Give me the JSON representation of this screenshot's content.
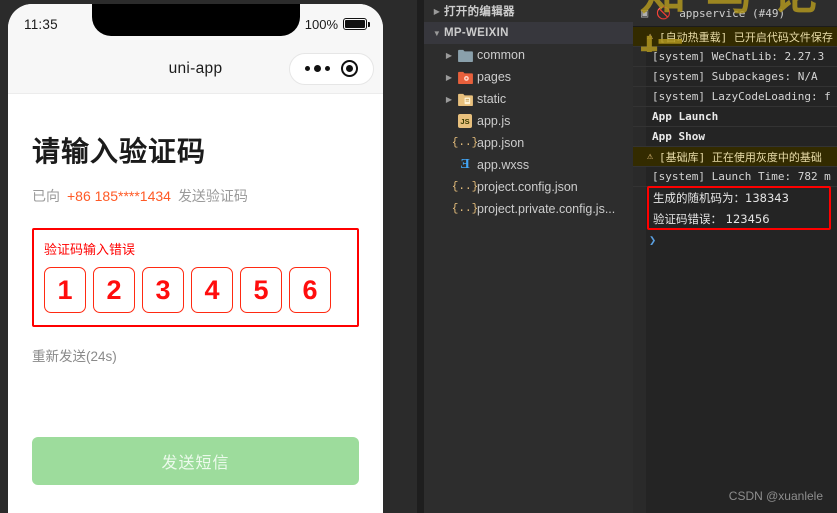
{
  "phone": {
    "statusbar": {
      "time": "11:35",
      "battery_pct": "100%"
    },
    "navbar": {
      "title": "uni-app",
      "capsule_more_icon": "more-dots-icon",
      "capsule_target_icon": "target-icon"
    },
    "content": {
      "heading": "请输入验证码",
      "sub_prefix": "已向",
      "phone_number": "+86 185****1434",
      "sub_suffix": "发送验证码",
      "error_text": "验证码输入错误",
      "code_digits": [
        "1",
        "2",
        "3",
        "4",
        "5",
        "6"
      ],
      "resend_text": "重新发送(24s)",
      "send_button": "发送短信"
    },
    "colors": {
      "error_red": "#ff0000",
      "phone_orange": "#ff5a26",
      "button_green": "#9ddc9c"
    }
  },
  "explorer": {
    "sections": [
      {
        "label": "打开的编辑器",
        "expanded": false,
        "icon": "chevron-right-icon"
      },
      {
        "label": "MP-WEIXIN",
        "expanded": true,
        "icon": "chevron-down-icon",
        "active": true
      }
    ],
    "files": [
      {
        "label": "common",
        "type": "folder",
        "icon": "folder-icon",
        "expandable": true,
        "color": "#8aa0ab"
      },
      {
        "label": "pages",
        "type": "folder",
        "icon": "folder-pages-icon",
        "expandable": true,
        "color": "#e8603c"
      },
      {
        "label": "static",
        "type": "folder",
        "icon": "folder-static-icon",
        "expandable": true,
        "color": "#e8c07d"
      },
      {
        "label": "app.js",
        "type": "js",
        "icon": "js-file-icon",
        "expandable": false
      },
      {
        "label": "app.json",
        "type": "json",
        "icon": "json-file-icon",
        "expandable": false
      },
      {
        "label": "app.wxss",
        "type": "css",
        "icon": "css-file-icon",
        "expandable": false
      },
      {
        "label": "project.config.json",
        "type": "json",
        "icon": "json-file-icon",
        "expandable": false
      },
      {
        "label": "project.private.config.js...",
        "type": "json",
        "icon": "json-file-icon",
        "expandable": false
      }
    ]
  },
  "console": {
    "toolbar": {
      "filter_icon": "filter-icon",
      "clear_icon": "clear-console-icon",
      "scope": "appservice (#49)"
    },
    "rows": [
      {
        "text": "[自动热重载] 已开启代码文件保存",
        "level": "warn",
        "icon": "warning-icon"
      },
      {
        "text": "[system] WeChatLib: 2.27.3",
        "level": "info"
      },
      {
        "text": "[system] Subpackages: N/A",
        "level": "info"
      },
      {
        "text": "[system] LazyCodeLoading: f",
        "level": "info"
      },
      {
        "text": "App Launch",
        "level": "bold"
      },
      {
        "text": "App Show",
        "level": "bold"
      },
      {
        "text": "[基础库] 正在使用灰度中的基础",
        "level": "warn",
        "icon": "warning-icon"
      },
      {
        "text": "[system] Launch Time: 782 m",
        "level": "info"
      }
    ],
    "highlighted_output": [
      "生成的随机码为：138343",
      "验证码错误： 123456"
    ],
    "prompt": "❯"
  },
  "watermarks": {
    "cn_text": "知 乌 论 坛",
    "csdn": "CSDN @xuanlele"
  }
}
